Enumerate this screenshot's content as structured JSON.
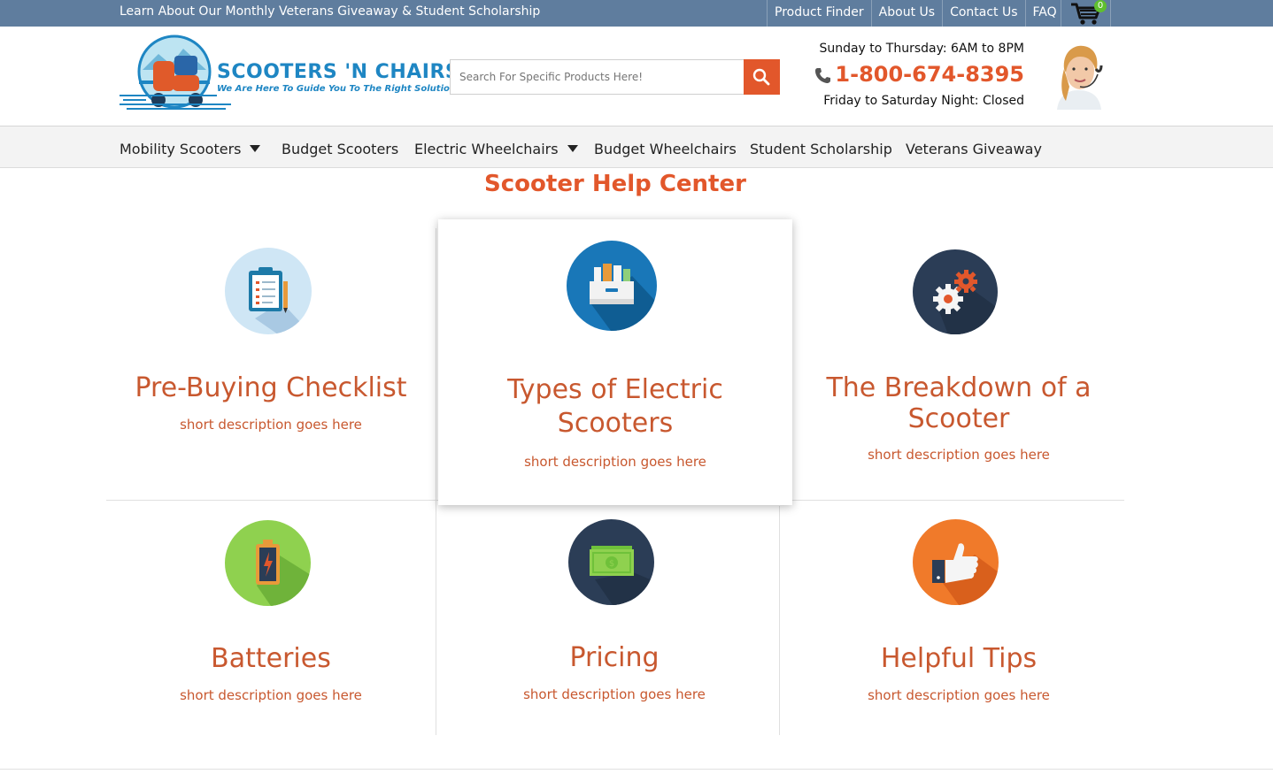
{
  "topbar": {
    "promo": "Learn About Our Monthly Veterans Giveaway & Student Scholarship",
    "links": [
      "Product Finder",
      "About Us",
      "Contact Us",
      "FAQ"
    ],
    "cart_count": "0"
  },
  "header": {
    "logo_brand": "SCOOTERS 'N CHAIRS",
    "logo_tagline": "We Are Here To Guide You To The Right Solution",
    "search_placeholder": "Search For Specific Products Here!",
    "hours_weekday": "Sunday to Thursday: 6AM to 8PM",
    "phone": "1-800-674-8395",
    "hours_weekend": "Friday to Saturday Night: Closed"
  },
  "nav": {
    "items": [
      "Mobility Scooters",
      "Budget Scooters",
      "Electric Wheelchairs",
      "Budget Wheelchairs",
      "Student Scholarship",
      "Veterans Giveaway"
    ]
  },
  "main": {
    "title": "Scooter Help Center",
    "cards": [
      {
        "title": "Pre-Buying Checklist",
        "desc": "short description goes here",
        "icon": "clipboard-icon"
      },
      {
        "title_line1": "Types of Electric",
        "title_line2": "Scooters",
        "desc": "short description goes here",
        "icon": "box-files-icon"
      },
      {
        "title_line1": "The Breakdown of a",
        "title_line2": "Scooter",
        "desc": "short description goes here",
        "icon": "gears-icon"
      },
      {
        "title": "Batteries",
        "desc": "short description goes here",
        "icon": "battery-icon"
      },
      {
        "title": "Pricing",
        "desc": "short description goes here",
        "icon": "money-icon"
      },
      {
        "title": "Helpful Tips",
        "desc": "short description goes here",
        "icon": "thumbs-up-icon"
      }
    ]
  },
  "colors": {
    "topbar": "#5f7d9e",
    "accent": "#e2572b",
    "card_text": "#c8582f"
  }
}
